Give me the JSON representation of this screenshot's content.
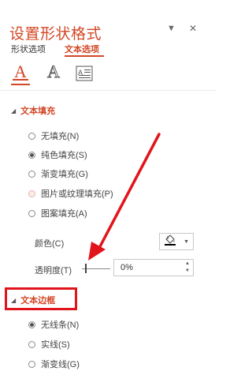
{
  "header": {
    "title": "设置形状格式",
    "dropdown_icon": "▼",
    "close_icon": "✕"
  },
  "tabs": [
    {
      "label": "形状选项",
      "selected": false
    },
    {
      "label": "文本选项",
      "selected": true
    }
  ],
  "icon_tabs": [
    {
      "name": "text-fill-outline-icon",
      "glyph": "A",
      "selected": true
    },
    {
      "name": "text-effects-icon",
      "glyph": "A",
      "selected": false
    },
    {
      "name": "textbox-icon",
      "glyph": "A",
      "selected": false
    }
  ],
  "fill_section": {
    "title": "文本填充",
    "expanded": true,
    "options": [
      {
        "label": "无填充(N)",
        "selected": false
      },
      {
        "label": "纯色填充(S)",
        "selected": true
      },
      {
        "label": "渐变填充(G)",
        "selected": false
      },
      {
        "label": "图片或纹理填充(P)",
        "selected": false
      },
      {
        "label": "图案填充(A)",
        "selected": false
      }
    ],
    "color_label": "颜色(C)",
    "transparency_label": "透明度(T)",
    "transparency_value": "0%"
  },
  "border_section": {
    "title": "文本边框",
    "expanded": false,
    "options": [
      {
        "label": "无线条(N)",
        "selected": true
      },
      {
        "label": "实线(S)",
        "selected": false
      },
      {
        "label": "渐变线(G)",
        "selected": false
      }
    ]
  },
  "colors": {
    "accent": "#d24726",
    "highlight_box": "#e1141b",
    "arrow": "#e1141b"
  }
}
